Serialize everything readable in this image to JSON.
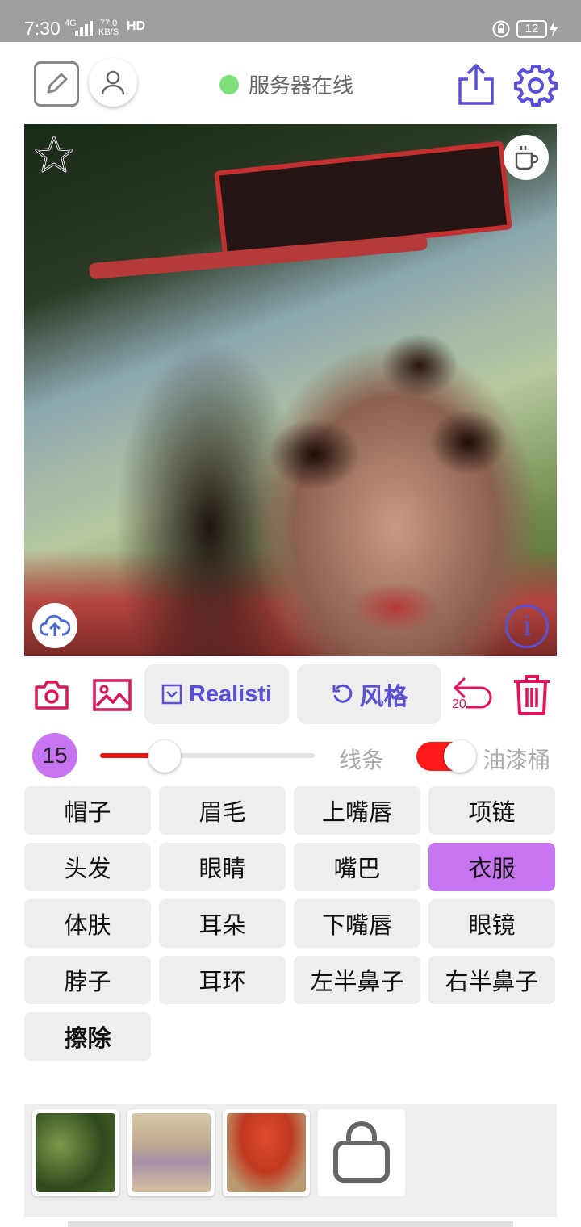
{
  "status_bar": {
    "time": "7:30",
    "network_type": "4G",
    "speed_value": "77.0",
    "speed_unit": "KB/S",
    "hd": "HD",
    "battery": "12"
  },
  "header": {
    "server_status": "服务器在线"
  },
  "toolbar": {
    "model_label": "Realisti",
    "style_label": "风格",
    "undo_count": "20"
  },
  "controls": {
    "brush_size": "15",
    "slider_level": 0.3,
    "line_label": "线条",
    "paint_bucket_label": "油漆桶",
    "paint_bucket_on": true
  },
  "parts": [
    {
      "label": "帽子",
      "selected": false
    },
    {
      "label": "眉毛",
      "selected": false
    },
    {
      "label": "上嘴唇",
      "selected": false
    },
    {
      "label": "项链",
      "selected": false
    },
    {
      "label": "头发",
      "selected": false
    },
    {
      "label": "眼睛",
      "selected": false
    },
    {
      "label": "嘴巴",
      "selected": false
    },
    {
      "label": "衣服",
      "selected": true
    },
    {
      "label": "体肤",
      "selected": false
    },
    {
      "label": "耳朵",
      "selected": false
    },
    {
      "label": "下嘴唇",
      "selected": false
    },
    {
      "label": "眼镜",
      "selected": false
    },
    {
      "label": "脖子",
      "selected": false
    },
    {
      "label": "耳环",
      "selected": false
    },
    {
      "label": "左半鼻子",
      "selected": false
    },
    {
      "label": "右半鼻子",
      "selected": false
    },
    {
      "label": "擦除",
      "selected": false,
      "bold": true
    }
  ],
  "colors": {
    "accent": "#5a4fd6",
    "danger": "#e0145a",
    "selected": "#c774f0",
    "online": "#7ee07a",
    "slider": "#ee1111"
  },
  "icons": [
    "edit-icon",
    "user-icon",
    "share-icon",
    "settings-icon",
    "star-icon",
    "coffee-icon",
    "cloud-upload-icon",
    "info-icon",
    "camera-icon",
    "image-icon",
    "undo-icon",
    "trash-icon",
    "shopping-bag-icon"
  ]
}
